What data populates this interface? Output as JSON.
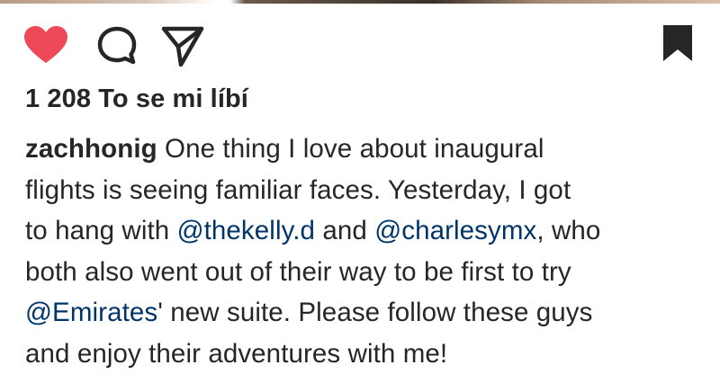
{
  "post": {
    "likes_text": "1 208 To se mi líbí",
    "username": "zachhonig",
    "caption_lines": {
      "l1": " One thing I love about inaugural",
      "l2": "flights is seeing familiar faces. Yesterday, I got",
      "l3a": "to hang with ",
      "l3_mention1": "@thekelly.d",
      "l3b": " and ",
      "l3_mention2": "@charlesymx",
      "l3c": ", who",
      "l4": "both also went out of their way to be first to try",
      "l5_mention": "@Emirates",
      "l5b": "' new suite. Please follow these guys",
      "l6": "and enjoy their adventures with me!"
    }
  },
  "icons": {
    "like": "heart-icon",
    "comment": "comment-icon",
    "share": "share-icon",
    "save": "bookmark-icon"
  },
  "colors": {
    "liked_heart": "#ed4956",
    "text": "#262626",
    "mention": "#003569"
  }
}
